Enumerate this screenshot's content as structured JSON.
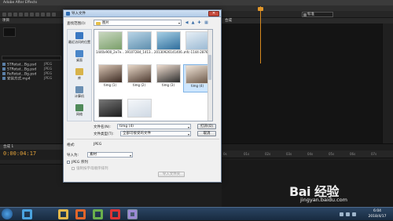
{
  "ae": {
    "title": "Adobe After Effects",
    "workspace": "标准",
    "project_tab": "项目",
    "comp_tab": "合成",
    "timeline_tab": "合成 1",
    "timecode": "0:00:04:17",
    "project_items": [
      {
        "name": "STRotat...Bg.psd",
        "type": "JPEG"
      },
      {
        "name": "STRotat...Bg.psd",
        "type": "JPEG"
      },
      {
        "name": "ReRotat...Bg.psd",
        "type": "JPEG"
      },
      {
        "name": "安装方式.mp4",
        "type": "JPEG"
      }
    ],
    "ruler_ticks": [
      "0s",
      "01s",
      "02s",
      "03s",
      "04s",
      "05s",
      "06s",
      "07s"
    ]
  },
  "dialog": {
    "title": "导入文件",
    "close_glyph": "✕",
    "look_in_label": "查找范围(I):",
    "look_in_value": "图片",
    "places": [
      {
        "label": "最近访问的位置",
        "color": "#3a78c2"
      },
      {
        "label": "桌面",
        "color": "#4a86c9"
      },
      {
        "label": "库",
        "color": "#d8b34a"
      },
      {
        "label": "计算机",
        "color": "#6a8fb3"
      },
      {
        "label": "网络",
        "color": "#4f8a5a"
      }
    ],
    "files": [
      {
        "name": "1440x900_2e7e...",
        "c1": "#7a9f6a",
        "c2": "#c9d7c0"
      },
      {
        "name": "39107284_1413...",
        "c1": "#5f8fae",
        "c2": "#b8d4e6"
      },
      {
        "name": "20130926141406...",
        "c1": "#2f6e9c",
        "c2": "#a6cfe5"
      },
      {
        "name": "mfc-1144-2876...",
        "c1": "#9ab9d3",
        "c2": "#e6eef5"
      },
      {
        "name": "timg (1)",
        "c1": "#3b2a22",
        "c2": "#d9c5b4"
      },
      {
        "name": "timg (2)",
        "c1": "#4d3a30",
        "c2": "#e8d8c8"
      },
      {
        "name": "timg (3)",
        "c1": "#2c2c2c",
        "c2": "#f0ded0"
      },
      {
        "name": "timg (4)",
        "c1": "#6a5647",
        "c2": "#efe3d6"
      },
      {
        "name": "",
        "c1": "#1d1d1d",
        "c2": "#777777"
      },
      {
        "name": "",
        "c1": "#cfd9e4",
        "c2": "#f5f7fa"
      }
    ],
    "filename_label": "文件名(N):",
    "filename_value": "timg (4)",
    "filetype_label": "文件类型(T):",
    "filetype_value": "全部可接受的文件",
    "open_button": "打开(O)",
    "cancel_button": "取消",
    "format_label": "格式:",
    "format_value": "JPEG",
    "import_as_label": "导入为:",
    "import_as_value": "素材",
    "jpeg_seq_label": "JPEG 序列",
    "alpha_label": "强制按字母顺序排列",
    "import_folder_button": "导入文件夹"
  },
  "taskbar": {
    "time": "6:04",
    "date": "2018/4/17",
    "apps": [
      {
        "name": "ie",
        "color": "#4aa3df"
      },
      {
        "name": "folder",
        "color": "#e3b84a"
      },
      {
        "name": "firefox",
        "color": "#e0652a"
      },
      {
        "name": "media",
        "color": "#6ab04c"
      },
      {
        "name": "record",
        "color": "#d33"
      },
      {
        "name": "ae",
        "color": "#9b8ad6"
      }
    ]
  },
  "watermark": {
    "logo": "Bai 经验",
    "url": "jingyan.baidu.com"
  }
}
